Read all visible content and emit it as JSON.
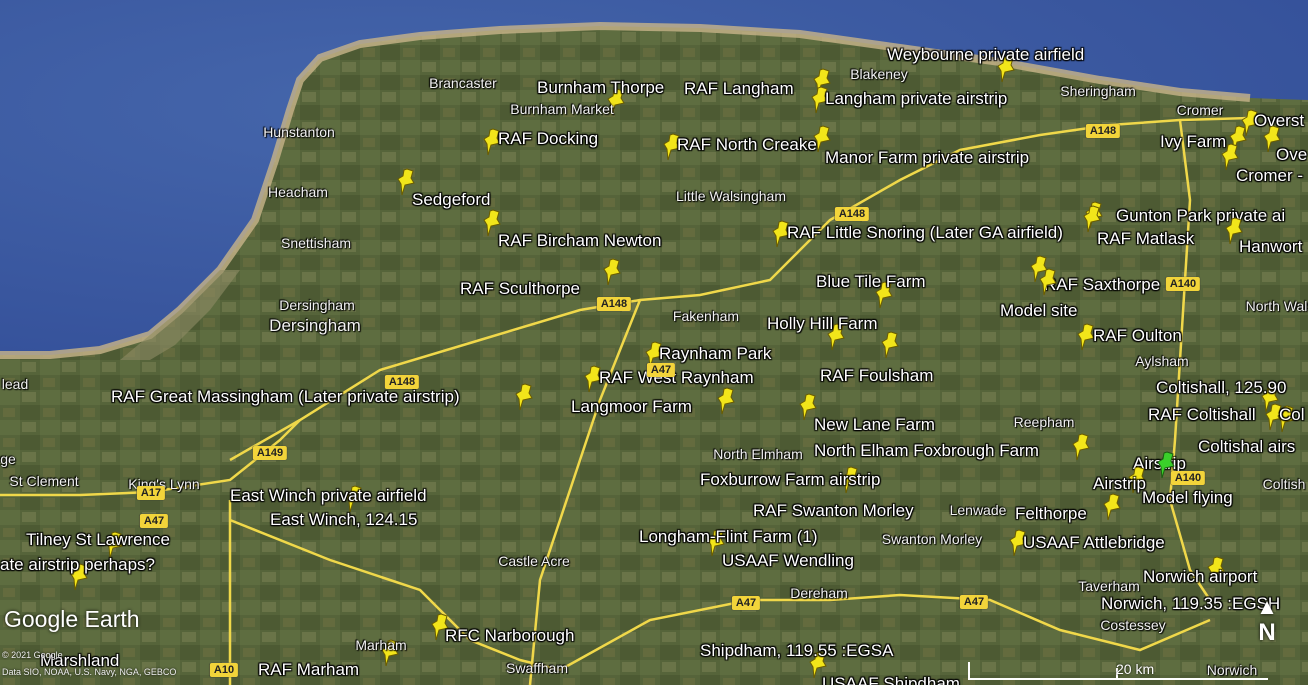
{
  "map": {
    "logo": "Google Earth",
    "copyright": "© 2021 Google",
    "credit": "Data SIO, NOAA, U.S. Navy, NGA, GEBCO",
    "scale_label": "20 km",
    "compass_label": "N",
    "colors": {
      "sea": "#3f5fa4",
      "sea_deep": "#35519a",
      "sand": "#c8b48a",
      "land": "#56643a",
      "road": "#f0d84a",
      "pin": "#f2e51a",
      "pin_green": "#3ad02a"
    },
    "pins": [
      {
        "label": "Weybourne private airfield",
        "color": "yellow"
      },
      {
        "label": "Burnham Thorpe",
        "color": "yellow"
      },
      {
        "label": "RAF Langham",
        "color": "yellow"
      },
      {
        "label": "Langham private airstrip",
        "color": "yellow"
      },
      {
        "label": "RAF Docking",
        "color": "yellow"
      },
      {
        "label": "RAF North Creake",
        "color": "yellow"
      },
      {
        "label": "Manor Farm private airstrip",
        "color": "yellow"
      },
      {
        "label": "Overst",
        "color": "yellow"
      },
      {
        "label": "Ivy Farm",
        "color": "yellow"
      },
      {
        "label": "Ove",
        "color": "yellow"
      },
      {
        "label": "Cromer -",
        "color": "yellow"
      },
      {
        "label": "Sedgeford",
        "color": "yellow"
      },
      {
        "label": "Gunton Park private ai",
        "color": "yellow"
      },
      {
        "label": "RAF Bircham Newton",
        "color": "yellow"
      },
      {
        "label": "RAF Little Snoring (Later GA airfield)",
        "color": "yellow"
      },
      {
        "label": "RAF Matlask",
        "color": "yellow"
      },
      {
        "label": "Hanwort",
        "color": "yellow"
      },
      {
        "label": "RAF Sculthorpe",
        "color": "yellow"
      },
      {
        "label": "Blue Tile Farm",
        "color": "yellow"
      },
      {
        "label": "RAF Saxthorpe",
        "color": "yellow"
      },
      {
        "label": "Model site",
        "color": "yellow"
      },
      {
        "label": "Holly Hill Farm",
        "color": "yellow"
      },
      {
        "label": "RAF Oulton",
        "color": "yellow"
      },
      {
        "label": "Raynham Park",
        "color": "yellow"
      },
      {
        "label": "RAF West Raynham",
        "color": "yellow"
      },
      {
        "label": "RAF Foulsham",
        "color": "yellow"
      },
      {
        "label": "Coltishall, 125.90",
        "color": "yellow"
      },
      {
        "label": "RAF Great Massingham (Later private airstrip)",
        "color": "yellow"
      },
      {
        "label": "Langmoor Farm",
        "color": "yellow"
      },
      {
        "label": "New Lane Farm",
        "color": "yellow"
      },
      {
        "label": "RAF Coltishall",
        "color": "yellow"
      },
      {
        "label": "Col",
        "color": "yellow"
      },
      {
        "label": "Coltishal airs",
        "color": "yellow"
      },
      {
        "label": "North Elham Foxbrough Farm",
        "color": "yellow"
      },
      {
        "label": "Airstrip",
        "color": "yellow"
      },
      {
        "label": "Foxburrow Farm airstrip",
        "color": "yellow"
      },
      {
        "label": "Airstrip",
        "color": "yellow"
      },
      {
        "label": "Model flying",
        "color": "green"
      },
      {
        "label": "East Winch private airfield",
        "color": "yellow"
      },
      {
        "label": "East Winch, 124.15",
        "color": "yellow"
      },
      {
        "label": "RAF Swanton Morley",
        "color": "yellow"
      },
      {
        "label": "Felthorpe",
        "color": "yellow"
      },
      {
        "label": "Tilney St Lawrence",
        "color": "yellow"
      },
      {
        "label": "Longham-Flint Farm (1)",
        "color": "yellow"
      },
      {
        "label": "USAAF Attlebridge",
        "color": "yellow"
      },
      {
        "label": "USAAF Wendling",
        "color": "yellow"
      },
      {
        "label": "ate airstrip perhaps?",
        "color": "yellow"
      },
      {
        "label": "Norwich airport",
        "color": "yellow"
      },
      {
        "label": "Norwich, 119.35 :EGSH",
        "color": "yellow"
      },
      {
        "label": "RFC Narborough",
        "color": "yellow"
      },
      {
        "label": "Shipdham, 119.55 :EGSA",
        "color": "yellow"
      },
      {
        "label": "RAF Marham",
        "color": "yellow"
      },
      {
        "label": "USAAF Shipdham",
        "color": "yellow"
      },
      {
        "label": "Marshland",
        "color": "yellow"
      }
    ],
    "places": [
      "Brancaster",
      "Blakeney",
      "Sheringham",
      "Burnham Market",
      "Hunstanton",
      "Cromer",
      "Heacham",
      "Little Walsingham",
      "Snettisham",
      "Dersingham",
      "Dersingham",
      "Fakenham",
      "Aylsham",
      "North Wals",
      "lead",
      "Reepham",
      "North Elmham",
      "ge",
      "St Clement",
      "King's Lynn",
      "Lenwade",
      "Coltish",
      "Swanton Morley",
      "Castle Acre",
      "Taverham",
      "Dereham",
      "Costessey",
      "Marham",
      "Swaffham",
      "Norwich"
    ],
    "roads": [
      "A148",
      "A148",
      "A148",
      "A148",
      "A140",
      "A140",
      "A149",
      "A17",
      "A47",
      "A47",
      "A47",
      "A47",
      "A10"
    ]
  }
}
